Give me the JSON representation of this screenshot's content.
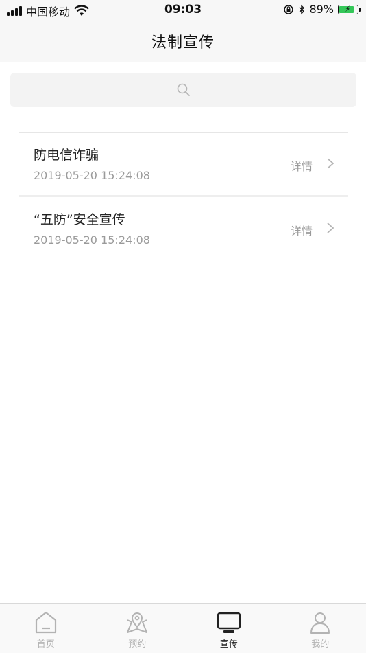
{
  "status_bar": {
    "carrier": "中国移动",
    "time": "09:03",
    "battery_percent": "89%",
    "battery_level": 0.89,
    "battery_color": "#34c759"
  },
  "navbar": {
    "title": "法制宣传"
  },
  "search": {
    "icon": "search-icon"
  },
  "list": {
    "items": [
      {
        "title": "防电信诈骗",
        "date": "2019-05-20 15:24:08",
        "detail": "详情"
      },
      {
        "title": "“五防”安全宣传",
        "date": "2019-05-20 15:24:08",
        "detail": "详情"
      }
    ]
  },
  "tabbar": {
    "active_color": "#222222",
    "inactive_color": "#b3b3b3",
    "tabs": [
      {
        "label": "首页",
        "icon": "home-icon",
        "active": false
      },
      {
        "label": "预约",
        "icon": "map-pin-icon",
        "active": false
      },
      {
        "label": "宣传",
        "icon": "tv-icon",
        "active": true
      },
      {
        "label": "我的",
        "icon": "user-icon",
        "active": false
      }
    ]
  }
}
